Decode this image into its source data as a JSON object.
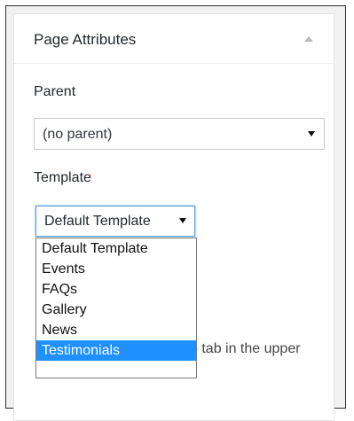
{
  "panel": {
    "title": "Page Attributes",
    "toggle_icon": "triangle-up-icon"
  },
  "parent": {
    "label": "Parent",
    "selected": "(no parent)"
  },
  "template": {
    "label": "Template",
    "selected": "Default Template",
    "options": [
      "Default Template",
      "Events",
      "FAQs",
      "Gallery",
      "News",
      "Testimonials"
    ],
    "highlighted": "Testimonials"
  },
  "help": {
    "partial_text": "p tab in the upper"
  },
  "colors": {
    "highlight": "#1e90ff",
    "focus_border": "#5b9dd9"
  }
}
